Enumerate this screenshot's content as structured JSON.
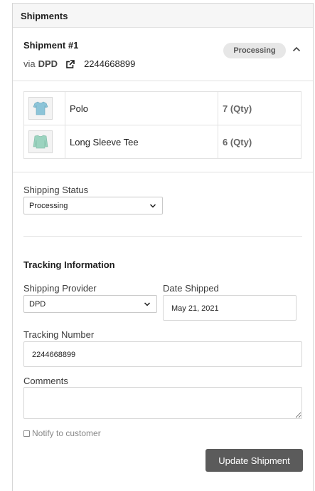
{
  "panel": {
    "title": "Shipments"
  },
  "shipment": {
    "title": "Shipment #1",
    "via_label": "via",
    "carrier": "DPD",
    "tracking_number": "2244668899",
    "status_badge": "Processing"
  },
  "items": [
    {
      "name": "Polo",
      "qty": "7 (Qty)",
      "thumb_color": "#8cc4d8"
    },
    {
      "name": "Long Sleeve Tee",
      "qty": "6 (Qty)",
      "thumb_color": "#9bd3bf"
    }
  ],
  "shipping_status": {
    "label": "Shipping Status",
    "value": "Processing"
  },
  "tracking": {
    "section_title": "Tracking Information",
    "provider": {
      "label": "Shipping Provider",
      "value": "DPD"
    },
    "date_shipped": {
      "label": "Date Shipped",
      "value": "May 21, 2021"
    },
    "tracking_number": {
      "label": "Tracking Number",
      "value": "2244668899"
    },
    "comments": {
      "label": "Comments",
      "value": ""
    },
    "notify_label": "Notify to customer"
  },
  "actions": {
    "update_label": "Update Shipment"
  },
  "colors": {
    "button_bg": "#5b5b5b",
    "badge_bg": "#e7e7e7"
  },
  "icons": {
    "external_link": "external-link-icon",
    "collapse": "chevron-up-icon",
    "select_arrow": "chevron-down-icon"
  }
}
